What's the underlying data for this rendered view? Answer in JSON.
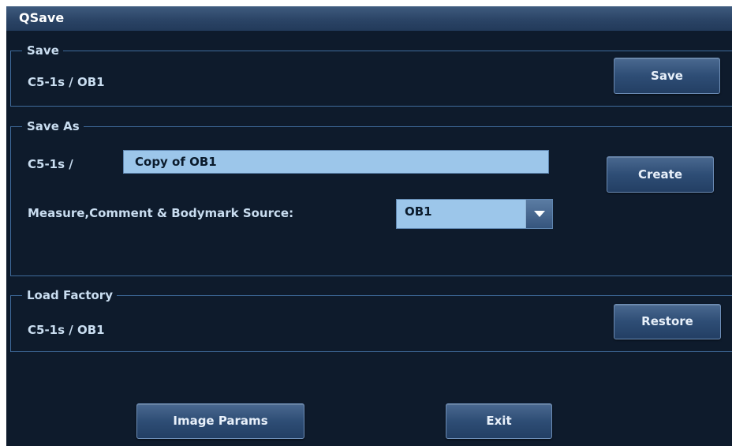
{
  "window": {
    "title": "QSave"
  },
  "save_group": {
    "legend": "Save",
    "path": "C5-1s  /  OB1",
    "button_label": "Save"
  },
  "save_as_group": {
    "legend": "Save As",
    "prefix": "C5-1s  /",
    "name_value": "Copy of OB1",
    "create_label": "Create",
    "source_label": "Measure,Comment & Bodymark Source:",
    "source_selected": "OB1"
  },
  "load_factory_group": {
    "legend": "Load Factory",
    "path": "C5-1s  /  OB1",
    "button_label": "Restore"
  },
  "footer": {
    "image_params_label": "Image Params",
    "exit_label": "Exit"
  },
  "icons": {
    "dropdown": "chevron-down-icon"
  },
  "colors": {
    "background": "#0e1b2c",
    "titlebar": "#2b4466",
    "group_border": "#3f6b9c",
    "label_text": "#c9ddf0",
    "input_fill": "#9cc6ea"
  }
}
